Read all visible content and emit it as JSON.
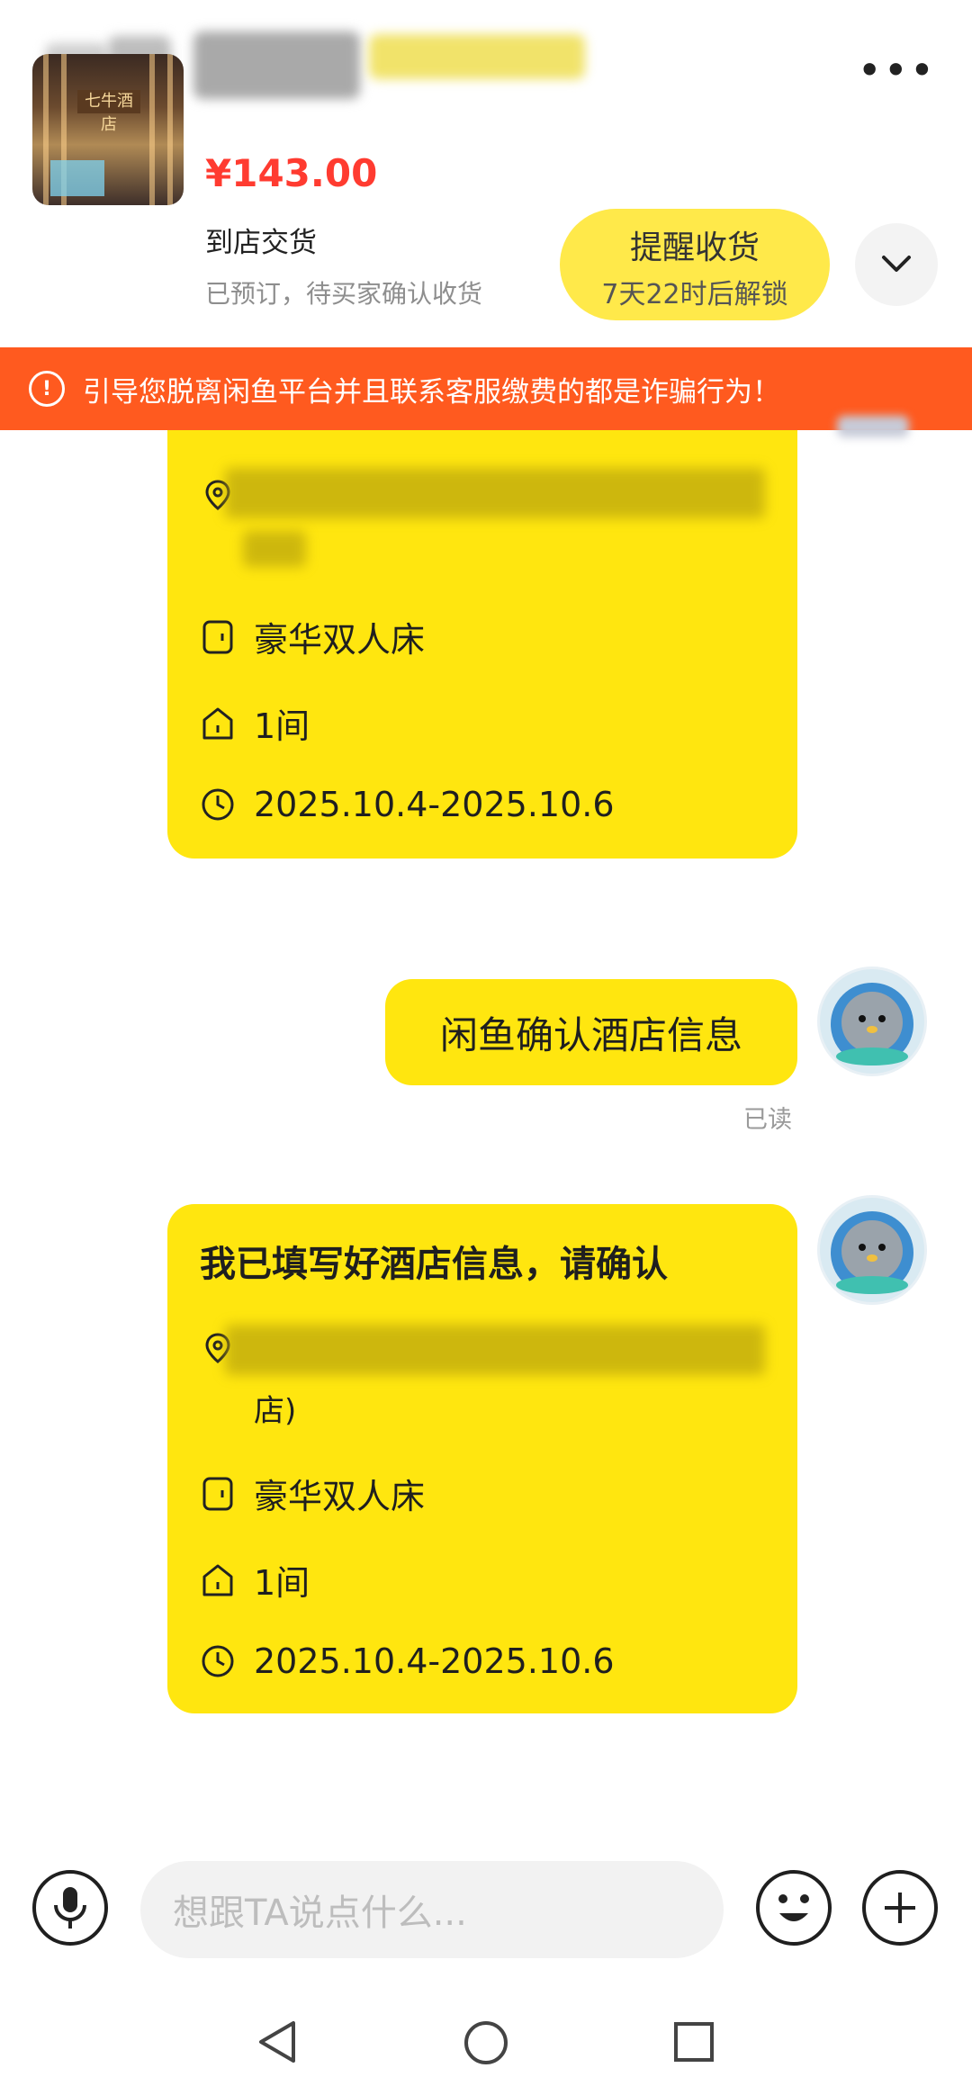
{
  "header": {
    "more_label": "•••"
  },
  "product": {
    "thumb_sign": "七牛酒店",
    "price": "¥143.00",
    "delivery": "到店交货",
    "status": "已预订，待买家确认收货",
    "remind_button": {
      "title": "提醒收货",
      "sub": "7天22时后解锁"
    }
  },
  "warning": "引导您脱离闲鱼平台并且联系客服缴费的都是诈骗行为！",
  "messages": {
    "card1": {
      "room": "豪华双人床",
      "count": "1间",
      "dates": "2025.10.4-2025.10.6"
    },
    "text_msg": "闲鱼确认酒店信息",
    "read_status": "已读",
    "card2": {
      "title": "我已填写好酒店信息，请确认",
      "addr_tail": "店)",
      "room": "豪华双人床",
      "count": "1间",
      "dates": "2025.10.4-2025.10.6"
    }
  },
  "input": {
    "placeholder": "想跟TA说点什么..."
  },
  "colors": {
    "accent_yellow": "#ffe60f",
    "warning_orange": "#ff5a1f",
    "price_red": "#ff3b30"
  },
  "icons": [
    "more-icon",
    "chevron-down-icon",
    "alert-icon",
    "location-icon",
    "bed-icon",
    "home-icon",
    "clock-icon",
    "mic-icon",
    "emoji-icon",
    "plus-icon",
    "back-icon",
    "home-nav-icon",
    "recents-icon"
  ]
}
